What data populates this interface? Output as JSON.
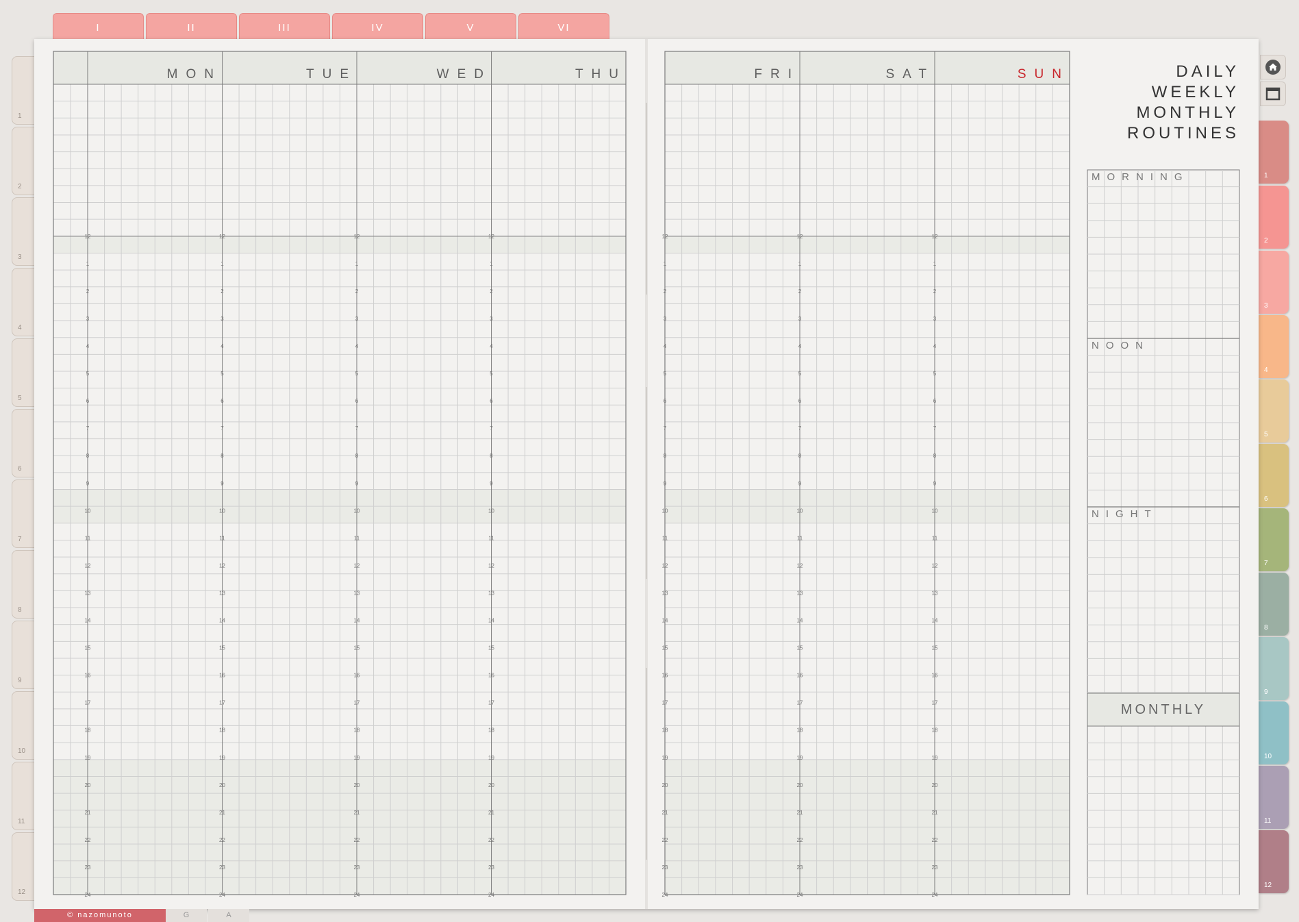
{
  "top_tabs": [
    "I",
    "II",
    "III",
    "IV",
    "V",
    "VI"
  ],
  "left_tabs": [
    "1",
    "2",
    "3",
    "4",
    "5",
    "6",
    "7",
    "8",
    "9",
    "10",
    "11",
    "12"
  ],
  "right_tabs": [
    {
      "label": "1",
      "color": "#d98c86"
    },
    {
      "label": "2",
      "color": "#f59592"
    },
    {
      "label": "3",
      "color": "#f7a8a2"
    },
    {
      "label": "4",
      "color": "#f8b789"
    },
    {
      "label": "5",
      "color": "#e8cb9a"
    },
    {
      "label": "6",
      "color": "#d9c17f"
    },
    {
      "label": "7",
      "color": "#a5b57a"
    },
    {
      "label": "8",
      "color": "#9bafa3"
    },
    {
      "label": "9",
      "color": "#a8c7c4"
    },
    {
      "label": "10",
      "color": "#8fc0c6"
    },
    {
      "label": "11",
      "color": "#ab9fb4"
    },
    {
      "label": "12",
      "color": "#b07f88"
    }
  ],
  "nav_icons": [
    "home-icon",
    "window-icon"
  ],
  "days_left": [
    {
      "label": "MON",
      "color": "#5f5f5f"
    },
    {
      "label": "TUE",
      "color": "#5f5f5f"
    },
    {
      "label": "WED",
      "color": "#5f5f5f"
    },
    {
      "label": "THU",
      "color": "#5f5f5f"
    }
  ],
  "days_right": [
    {
      "label": "FRI",
      "color": "#5f5f5f"
    },
    {
      "label": "SAT",
      "color": "#5f5f5f"
    },
    {
      "label": "SUN",
      "color": "#c8262c"
    }
  ],
  "hours": [
    "12",
    "1",
    "2",
    "3",
    "4",
    "5",
    "6",
    "7",
    "8",
    "9",
    "10",
    "11",
    "12",
    "13",
    "14",
    "15",
    "16",
    "17",
    "18",
    "19",
    "20",
    "21",
    "22",
    "23",
    "24"
  ],
  "title_lines": [
    "DAILY",
    "WEEKLY",
    "MONTHLY",
    "ROUTINES"
  ],
  "routines": {
    "morning": "MORNING",
    "noon": "NOON",
    "night": "NIGHT",
    "monthly": "MONTHLY"
  },
  "footer": {
    "credit": "© nazomunoto",
    "tab_g": "G",
    "tab_a": "A"
  },
  "colors": {
    "grid_line": "#cfcfcf",
    "grid_bold": "#7b7b7b",
    "shade": "#eaebe6",
    "header_bg": "#e7e8e3"
  }
}
